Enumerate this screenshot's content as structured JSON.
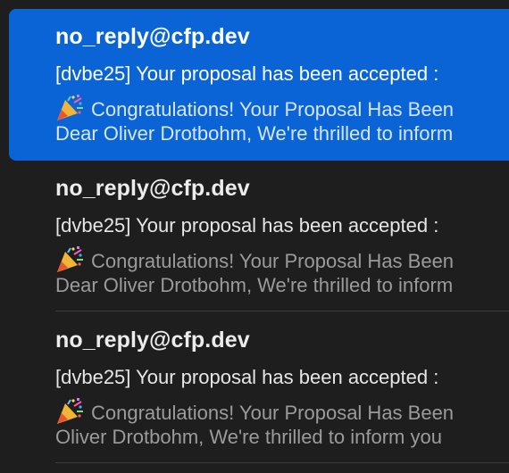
{
  "messages": [
    {
      "sender": "no_reply@cfp.dev",
      "subject": "[dvbe25] Your proposal has been accepted :",
      "preview_line1": "Congratulations! Your Proposal Has Been",
      "preview_line2": "Dear Oliver Drotbohm, We're thrilled to inform",
      "icon": "party-popper-icon",
      "selected": true
    },
    {
      "sender": "no_reply@cfp.dev",
      "subject": "[dvbe25] Your proposal has been accepted :",
      "preview_line1": "Congratulations! Your Proposal Has Been",
      "preview_line2": "Dear Oliver Drotbohm, We're thrilled to inform",
      "icon": "party-popper-icon",
      "selected": false
    },
    {
      "sender": "no_reply@cfp.dev",
      "subject": "[dvbe25] Your proposal has been accepted :",
      "preview_line1": "Congratulations! Your Proposal Has Been",
      "preview_line2": "Oliver Drotbohm, We're thrilled to inform you",
      "icon": "party-popper-icon",
      "selected": false
    }
  ],
  "colors": {
    "selected_background": "#0a64d6",
    "list_background": "#1f1e1e"
  }
}
